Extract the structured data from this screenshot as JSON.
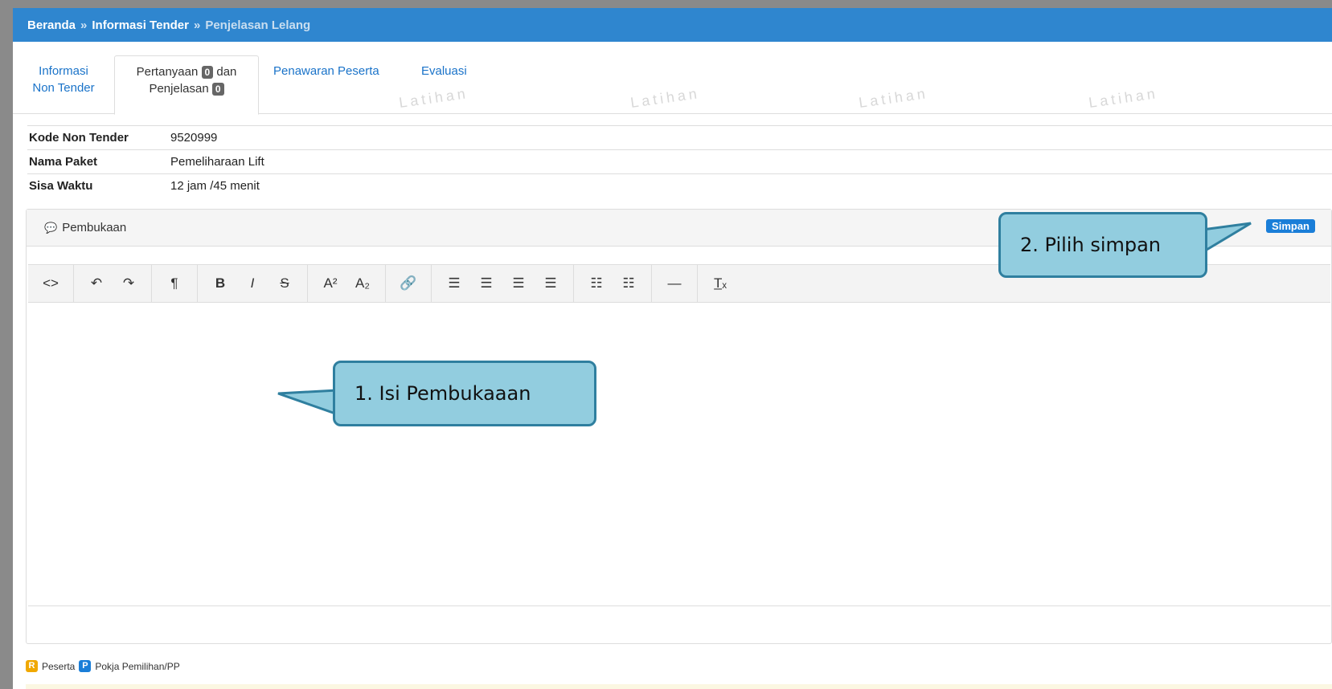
{
  "breadcrumb": {
    "items": [
      "Beranda",
      "Informasi Tender",
      "Penjelasan Lelang"
    ],
    "separator": "»"
  },
  "tabs": [
    {
      "line1": "Informasi",
      "line2": "Non Tender"
    },
    {
      "line1_prefix": "Pertanyaan",
      "line1_badge": "0",
      "line1_suffix": "dan",
      "line2_prefix": "Penjelasan",
      "line2_badge": "0"
    },
    {
      "label": "Penawaran Peserta"
    },
    {
      "label": "Evaluasi"
    }
  ],
  "watermark": "Latihan",
  "info": [
    {
      "label": "Kode Non Tender",
      "value": "9520999"
    },
    {
      "label": "Nama Paket",
      "value": "Pemeliharaan Lift"
    },
    {
      "label": "Sisa Waktu",
      "value": "12 jam /45 menit"
    }
  ],
  "panel": {
    "title": "Pembukaan",
    "title_icon": "comments-icon",
    "save_label": "Simpan"
  },
  "toolbar": {
    "groups": [
      [
        "code-view-icon"
      ],
      [
        "undo-icon",
        "redo-icon"
      ],
      [
        "paragraph-icon"
      ],
      [
        "bold-icon",
        "italic-icon",
        "strikethrough-icon"
      ],
      [
        "superscript-icon",
        "subscript-icon"
      ],
      [
        "link-icon"
      ],
      [
        "align-left-icon",
        "align-center-icon",
        "align-right-icon",
        "align-justify-icon"
      ],
      [
        "unordered-list-icon",
        "ordered-list-icon"
      ],
      [
        "horizontal-rule-icon"
      ],
      [
        "remove-format-icon"
      ]
    ]
  },
  "legend": {
    "peserta_badge": "R",
    "peserta_label": "Peserta",
    "pokja_badge": "P",
    "pokja_label": "Pokja Pemilihan/PP"
  },
  "callouts": {
    "step1": "1. Isi Pembukaaan",
    "step2": "2. Pilih simpan"
  },
  "colors": {
    "topbar": "#2f86cf",
    "link": "#1a73c9",
    "save_button": "#1a7ed8",
    "callout_fill": "#92cddf",
    "callout_border": "#2f7f9f"
  }
}
